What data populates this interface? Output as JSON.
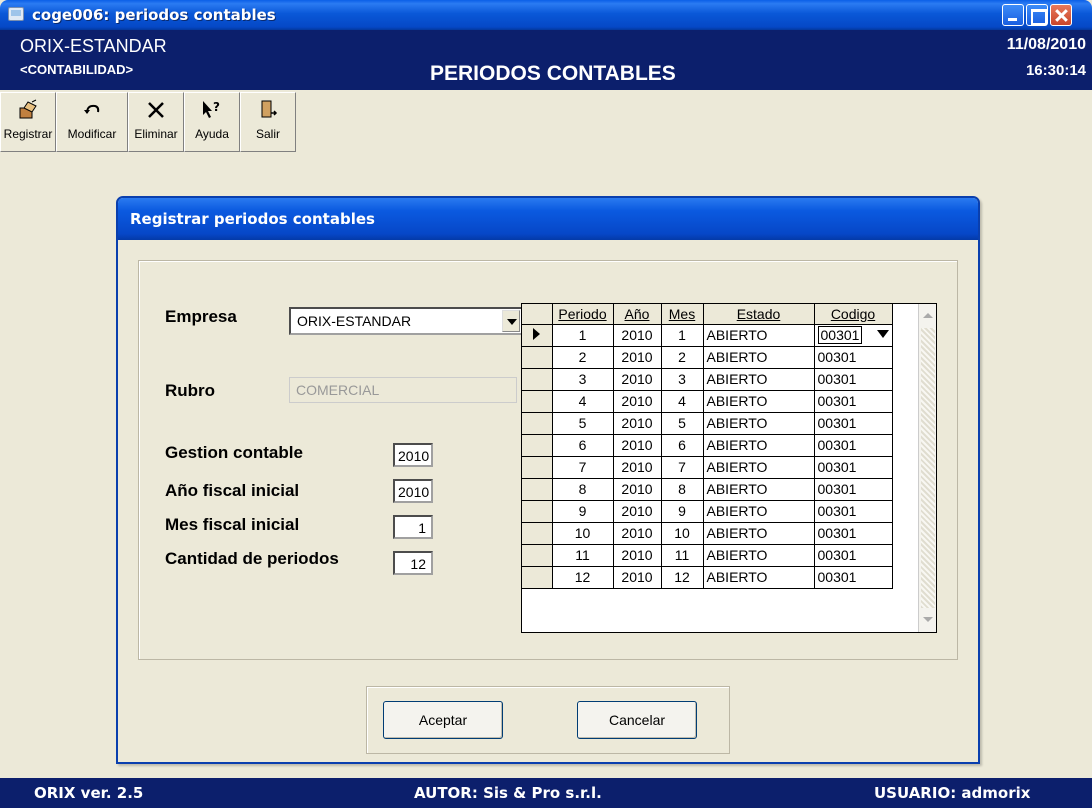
{
  "window": {
    "title": "coge006: periodos contables"
  },
  "header": {
    "company": "ORIX-ESTANDAR",
    "module": "<CONTABILIDAD>",
    "heading": "PERIODOS CONTABLES",
    "date": "11/08/2010",
    "time": "16:30:14"
  },
  "toolbar": [
    {
      "label": "Registrar",
      "icon": "register-icon"
    },
    {
      "label": "Modificar",
      "icon": "undo-icon"
    },
    {
      "label": "Eliminar",
      "icon": "delete-icon"
    },
    {
      "label": "Ayuda",
      "icon": "help-icon"
    },
    {
      "label": "Salir",
      "icon": "exit-door-icon"
    }
  ],
  "dialog": {
    "title": "Registrar periodos contables",
    "empresa_label": "Empresa",
    "empresa_value": "ORIX-ESTANDAR",
    "rubro_label": "Rubro",
    "rubro_value": "COMERCIAL",
    "gestion_label": "Gestion contable",
    "gestion_value": "2010",
    "anio_fiscal_label": "Año fiscal inicial",
    "anio_fiscal_value": "2010",
    "mes_fiscal_label": "Mes fiscal inicial",
    "mes_fiscal_value": "1",
    "cantidad_label": "Cantidad de periodos",
    "cantidad_value": "12",
    "accept_label": "Aceptar",
    "cancel_label": "Cancelar"
  },
  "grid": {
    "columns": [
      "Periodo",
      "Año",
      "Mes",
      "Estado",
      "Codigo"
    ],
    "rows": [
      [
        "1",
        "2010",
        "1",
        "ABIERTO",
        "00301"
      ],
      [
        "2",
        "2010",
        "2",
        "ABIERTO",
        "00301"
      ],
      [
        "3",
        "2010",
        "3",
        "ABIERTO",
        "00301"
      ],
      [
        "4",
        "2010",
        "4",
        "ABIERTO",
        "00301"
      ],
      [
        "5",
        "2010",
        "5",
        "ABIERTO",
        "00301"
      ],
      [
        "6",
        "2010",
        "6",
        "ABIERTO",
        "00301"
      ],
      [
        "7",
        "2010",
        "7",
        "ABIERTO",
        "00301"
      ],
      [
        "8",
        "2010",
        "8",
        "ABIERTO",
        "00301"
      ],
      [
        "9",
        "2010",
        "9",
        "ABIERTO",
        "00301"
      ],
      [
        "10",
        "2010",
        "10",
        "ABIERTO",
        "00301"
      ],
      [
        "11",
        "2010",
        "11",
        "ABIERTO",
        "00301"
      ],
      [
        "12",
        "2010",
        "12",
        "ABIERTO",
        "00301"
      ]
    ]
  },
  "status": {
    "version": "ORIX ver. 2.5",
    "author": "AUTOR: Sis & Pro s.r.l.",
    "user": "USUARIO: admorix"
  }
}
